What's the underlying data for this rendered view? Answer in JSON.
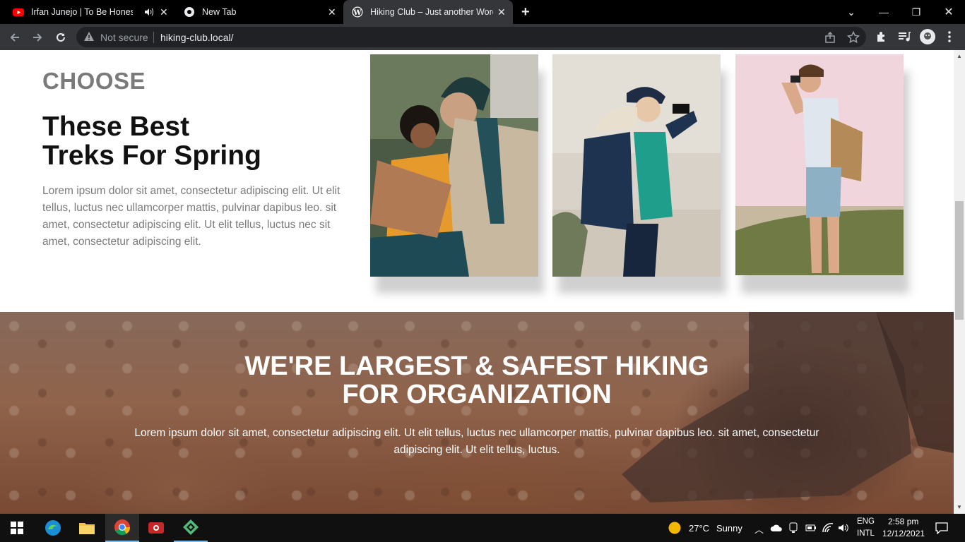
{
  "browser": {
    "tabs": [
      {
        "title": "Irfan Junejo | To Be Honest |",
        "icon": "youtube-icon"
      },
      {
        "title": "New Tab",
        "icon": "chrome-icon"
      },
      {
        "title": "Hiking Club – Just another WordPress site",
        "icon": "wordpress-icon"
      }
    ],
    "security_label": "Not secure",
    "url": "hiking-club.local/"
  },
  "page": {
    "choose_label": "CHOOSE",
    "heading_line1": "These Best",
    "heading_line2": "Treks For Spring",
    "intro_text": "Lorem ipsum dolor sit amet, consectetur adipiscing elit. Ut elit tellus, luctus nec ullamcorper mattis, pulvinar dapibus leo. sit amet, consectetur adipiscing elit. Ut elit tellus, luctus nec sit amet, consectetur adipiscing elit.",
    "hero_title_line1": "WE'RE LARGEST & SAFEST HIKING",
    "hero_title_line2": "FOR ORGANIZATION",
    "hero_text": "Lorem ipsum dolor sit amet, consectetur adipiscing elit. Ut elit tellus, luctus nec ullamcorper mattis, pulvinar dapibus leo. sit amet, consectetur adipiscing elit. Ut elit tellus, luctus."
  },
  "taskbar": {
    "weather_temp": "27°C",
    "weather_desc": "Sunny",
    "lang_line1": "ENG",
    "lang_line2": "INTL",
    "time": "2:58 pm",
    "date": "12/12/2021"
  },
  "colors": {
    "accent_tab": "#35363a",
    "heading_gray": "#7a7a7a"
  }
}
